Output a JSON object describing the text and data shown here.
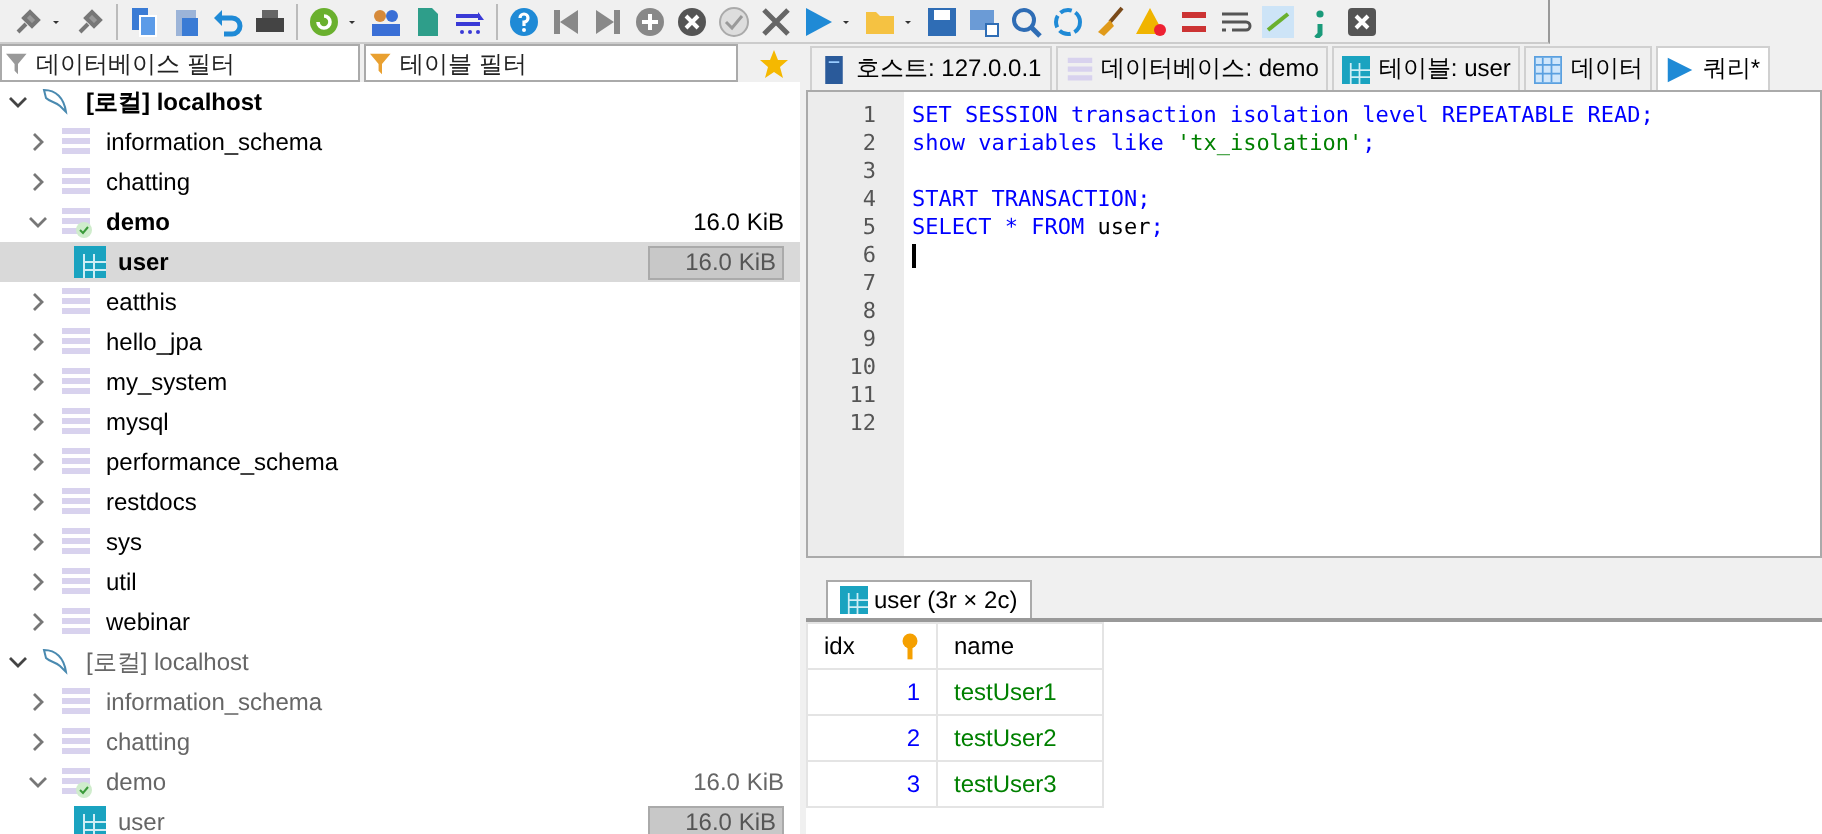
{
  "filters": {
    "database_placeholder": "데이터베이스 필터",
    "table_placeholder": "테이블 필터"
  },
  "tree": [
    {
      "label": "[로컬] localhost",
      "expanded": true,
      "dimmed": false,
      "children": [
        {
          "label": "information_schema",
          "expanded": false,
          "active": false
        },
        {
          "label": "chatting",
          "expanded": false,
          "active": false
        },
        {
          "label": "demo",
          "expanded": true,
          "active": true,
          "size": "16.0 KiB",
          "children": [
            {
              "label": "user",
              "selected": true,
              "size": "16.0 KiB"
            }
          ]
        },
        {
          "label": "eatthis",
          "expanded": false,
          "active": false
        },
        {
          "label": "hello_jpa",
          "expanded": false,
          "active": false
        },
        {
          "label": "my_system",
          "expanded": false,
          "active": false
        },
        {
          "label": "mysql",
          "expanded": false,
          "active": false
        },
        {
          "label": "performance_schema",
          "expanded": false,
          "active": false
        },
        {
          "label": "restdocs",
          "expanded": false,
          "active": false
        },
        {
          "label": "sys",
          "expanded": false,
          "active": false
        },
        {
          "label": "util",
          "expanded": false,
          "active": false
        },
        {
          "label": "webinar",
          "expanded": false,
          "active": false
        }
      ]
    },
    {
      "label": "[로컬] localhost",
      "expanded": true,
      "dimmed": true,
      "children": [
        {
          "label": "information_schema",
          "expanded": false,
          "active": false
        },
        {
          "label": "chatting",
          "expanded": false,
          "active": false
        },
        {
          "label": "demo",
          "expanded": true,
          "active": true,
          "size": "16.0 KiB",
          "children": [
            {
              "label": "user",
              "selected": false,
              "size": "16.0 KiB"
            }
          ]
        }
      ]
    }
  ],
  "tabs": [
    {
      "label": "호스트: 127.0.0.1",
      "kind": "host",
      "selected": false
    },
    {
      "label": "데이터베이스: demo",
      "kind": "database",
      "selected": false
    },
    {
      "label": "테이블: user",
      "kind": "table",
      "selected": false
    },
    {
      "label": "데이터",
      "kind": "data",
      "selected": false
    },
    {
      "label": "쿼리*",
      "kind": "query",
      "selected": true
    }
  ],
  "editor": {
    "lines": [
      {
        "number": "1",
        "tokens": [
          {
            "text": "SET SESSION transaction isolation level REPEATABLE READ;",
            "kind": "keyword"
          }
        ]
      },
      {
        "number": "2",
        "tokens": [
          {
            "text": "show variables like ",
            "kind": "keyword"
          },
          {
            "text": "'tx_isolation'",
            "kind": "string"
          },
          {
            "text": ";",
            "kind": "keyword"
          }
        ]
      },
      {
        "number": "3"
      },
      {
        "number": "4",
        "tokens": [
          {
            "text": "START TRANSACTION;",
            "kind": "keyword"
          }
        ]
      },
      {
        "number": "5",
        "tokens": [
          {
            "text": "SELECT * FROM ",
            "kind": "keyword"
          },
          {
            "text": "user",
            "kind": "plain"
          },
          {
            "text": ";",
            "kind": "keyword"
          }
        ]
      },
      {
        "number": "6",
        "cursor": true
      },
      {
        "number": "7"
      },
      {
        "number": "8"
      },
      {
        "number": "9"
      },
      {
        "number": "10"
      },
      {
        "number": "11"
      },
      {
        "number": "12"
      }
    ]
  },
  "result": {
    "tab": "user (3r × 2c)",
    "columns": [
      "idx",
      "name"
    ],
    "rows": [
      [
        "1",
        "testUser1"
      ],
      [
        "2",
        "testUser2"
      ],
      [
        "3",
        "testUser3"
      ]
    ]
  }
}
